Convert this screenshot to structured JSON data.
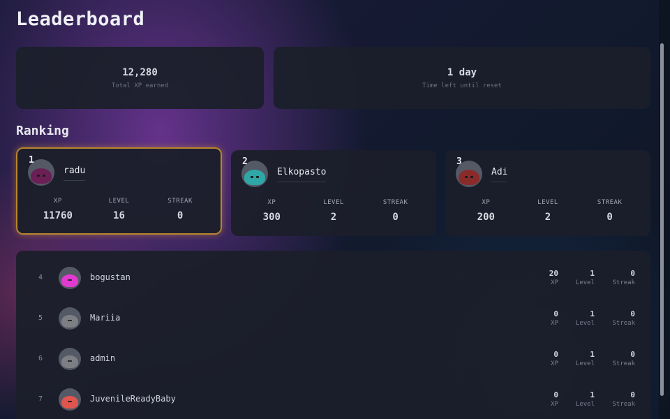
{
  "title": "Leaderboard",
  "stats": [
    {
      "value": "12,280",
      "label": "Total XP earned"
    },
    {
      "value": "1 day",
      "label": "Time left until reset"
    }
  ],
  "ranking_title": "Ranking",
  "podium": [
    {
      "rank": "1",
      "name": "radu",
      "xp": "11760",
      "level": "16",
      "streak": "0",
      "avatar_color": "#6a1f55"
    },
    {
      "rank": "2",
      "name": "Elkopasto",
      "xp": "300",
      "level": "2",
      "streak": "0",
      "avatar_color": "#2fa7a6"
    },
    {
      "rank": "3",
      "name": "Adi",
      "xp": "200",
      "level": "2",
      "streak": "0",
      "avatar_color": "#8a2b2b"
    }
  ],
  "podium_labels": {
    "xp": "XP",
    "level": "LEVEL",
    "streak": "STREAK"
  },
  "row_labels": {
    "xp": "XP",
    "level": "Level",
    "streak": "Streak"
  },
  "list": [
    {
      "rank": "4",
      "name": "bogustan",
      "xp": "20",
      "level": "1",
      "streak": "0",
      "avatar_color": "#e13ad0"
    },
    {
      "rank": "5",
      "name": "Mariia",
      "xp": "0",
      "level": "1",
      "streak": "0",
      "avatar_color": "#7d7f84"
    },
    {
      "rank": "6",
      "name": "admin",
      "xp": "0",
      "level": "1",
      "streak": "0",
      "avatar_color": "#7d7f84"
    },
    {
      "rank": "7",
      "name": "JuvenileReadyBaby",
      "xp": "0",
      "level": "1",
      "streak": "0",
      "avatar_color": "#e0554e"
    }
  ]
}
